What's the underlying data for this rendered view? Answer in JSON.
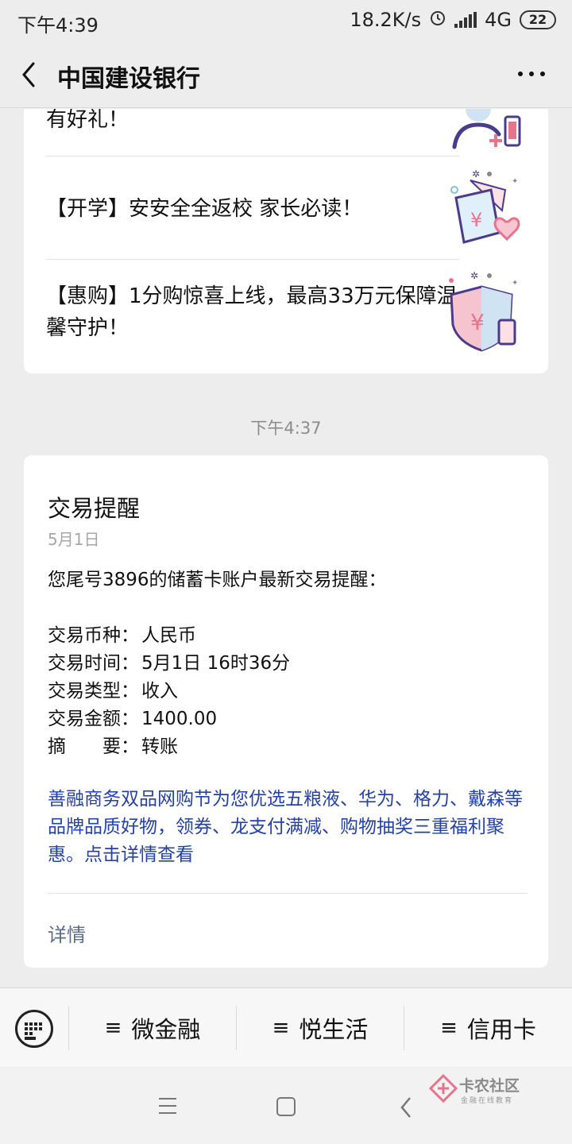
{
  "status_bar": {
    "time": "下午4:39",
    "speed": "18.2K/s",
    "network": "4G",
    "battery": "22"
  },
  "header": {
    "title": "中国建设银行"
  },
  "articles": [
    {
      "title": "有好礼！"
    },
    {
      "title": "【开学】安安全全返校 家长必读！"
    },
    {
      "title": "【惠购】1分购惊喜上线，最高33万元保障温馨守护！"
    }
  ],
  "timestamp": "下午4:37",
  "notification": {
    "title": "交易提醒",
    "date": "5月1日",
    "intro": "您尾号3896的储蓄卡账户最新交易提醒：",
    "fields": [
      {
        "key": "交易币种：",
        "value": "人民币"
      },
      {
        "key": "交易时间：",
        "value": "5月1日 16时36分"
      },
      {
        "key": "交易类型：",
        "value": "收入"
      },
      {
        "key": "交易金额：",
        "value": "1400.00"
      },
      {
        "key": "摘　　要：",
        "value": "转账"
      }
    ],
    "promo": "善融商务双品网购节为您优选五粮液、华为、格力、戴森等品牌品质好物，领券、龙支付满减、购物抽奖三重福利聚惠。点击详情查看",
    "detail_link": "详情"
  },
  "menu": {
    "items": [
      {
        "label": "微金融"
      },
      {
        "label": "悦生活"
      },
      {
        "label": "信用卡"
      }
    ],
    "hamburger": "≡"
  },
  "watermark": {
    "text": "卡农社区",
    "sub": "金融在线教育"
  },
  "colors": {
    "link_blue": "#2342a8",
    "accent_pink": "#e8738f",
    "accent_purple": "#4a3b8c"
  }
}
